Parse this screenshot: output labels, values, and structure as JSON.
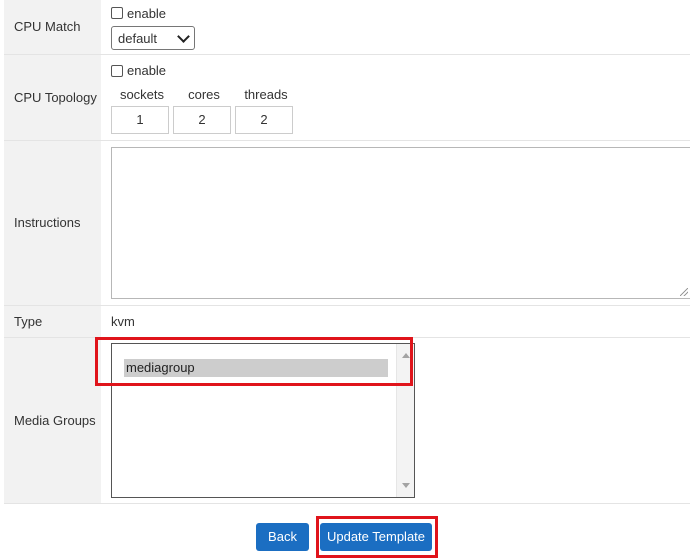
{
  "form": {
    "cpu_match": {
      "label": "CPU Match",
      "enable_label": "enable",
      "enabled": false,
      "selected": "default"
    },
    "cpu_topology": {
      "label": "CPU Topology",
      "enable_label": "enable",
      "enabled": false,
      "headers": [
        "sockets",
        "cores",
        "threads"
      ],
      "values": [
        "1",
        "2",
        "2"
      ]
    },
    "instructions": {
      "label": "Instructions",
      "value": ""
    },
    "type": {
      "label": "Type",
      "value": "kvm"
    },
    "media_groups": {
      "label": "Media Groups",
      "options": [
        "mediagroup"
      ]
    }
  },
  "actions": {
    "back_label": "Back",
    "update_label": "Update Template"
  },
  "colors": {
    "primary": "#1b6ec2",
    "highlight": "#e0141b",
    "label_bg": "#f2f2f2"
  }
}
